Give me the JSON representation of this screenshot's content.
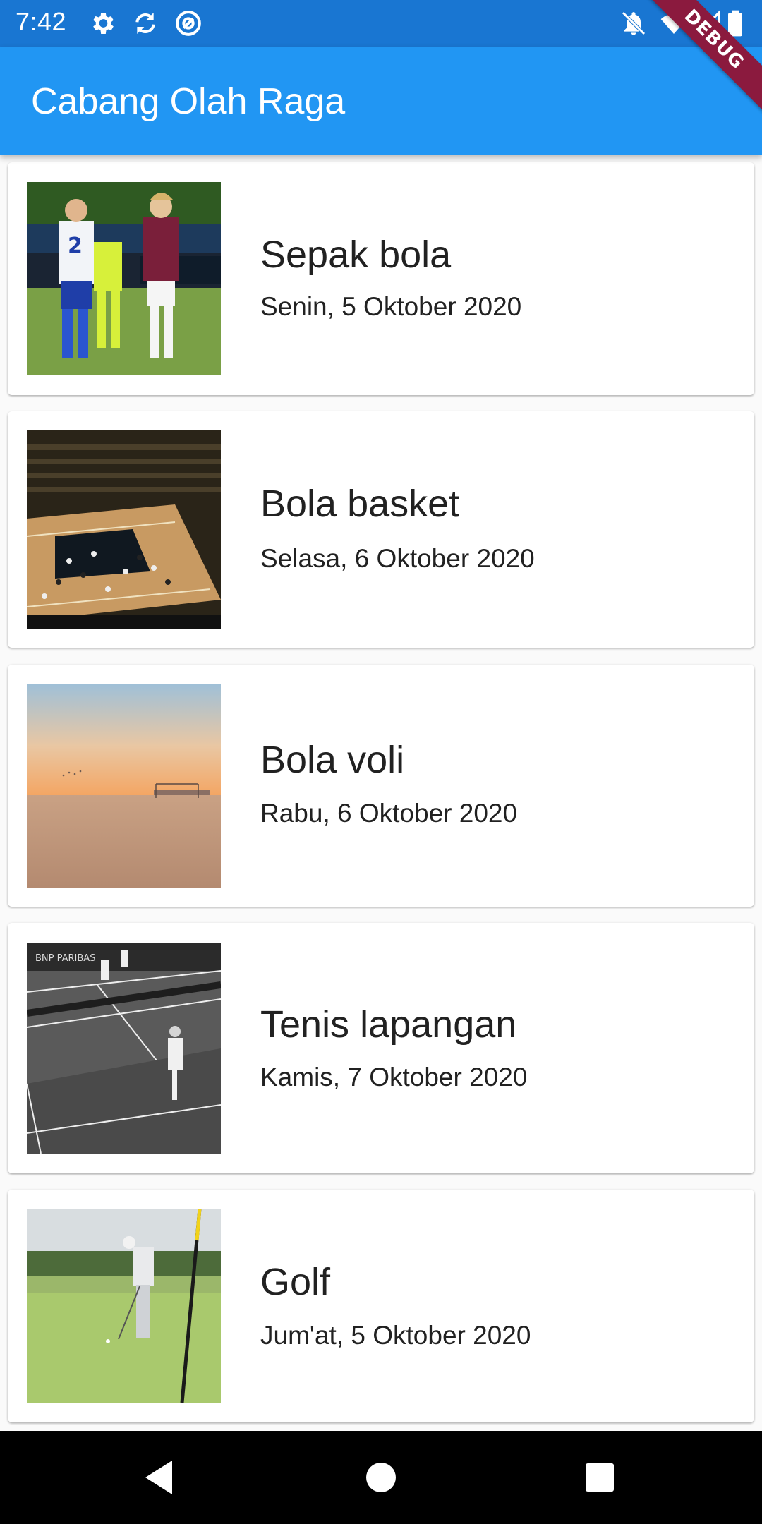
{
  "status_bar": {
    "time": "7:42",
    "left_icons": [
      "gear-icon",
      "sync-icon",
      "at-sign-icon"
    ],
    "right_icons": [
      "notifications-off-icon",
      "wifi-icon",
      "signal-icon",
      "battery-icon"
    ]
  },
  "app_bar": {
    "title": "Cabang Olah Raga"
  },
  "debug_banner": "DEBUG",
  "sports": [
    {
      "title": "Sepak bola",
      "date": "Senin, 5 Oktober 2020",
      "image": "football-photo"
    },
    {
      "title": "Bola basket",
      "date": "Selasa, 6 Oktober 2020",
      "image": "basketball-photo"
    },
    {
      "title": "Bola voli",
      "date": "Rabu, 6 Oktober 2020",
      "image": "beach-volleyball-photo"
    },
    {
      "title": "Tenis lapangan",
      "date": "Kamis, 7 Oktober 2020",
      "image": "tennis-photo"
    },
    {
      "title": "Golf",
      "date": "Jum'at, 5 Oktober 2020",
      "image": "golf-photo"
    }
  ],
  "nav_bar": {
    "buttons": [
      "back-icon",
      "home-icon",
      "recents-icon"
    ]
  },
  "colors": {
    "status_bar": "#1976d2",
    "app_bar": "#2196f3",
    "debug_banner": "#8b1a3e",
    "background": "#fafafa",
    "card": "#ffffff",
    "text": "#212121"
  }
}
